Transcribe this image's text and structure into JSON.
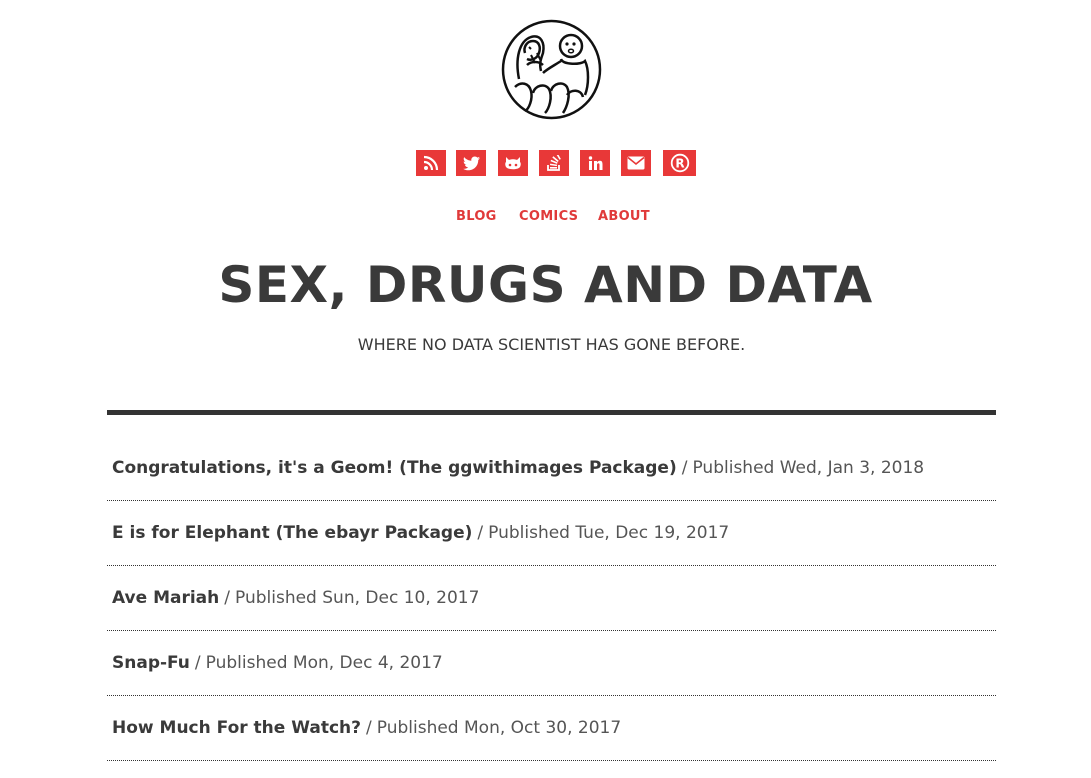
{
  "header": {
    "logo_name": "site-logo",
    "social": [
      {
        "icon": "rss-icon"
      },
      {
        "icon": "twitter-icon"
      },
      {
        "icon": "github-icon"
      },
      {
        "icon": "stackoverflow-icon"
      },
      {
        "icon": "linkedin-icon"
      },
      {
        "icon": "email-icon"
      },
      {
        "icon": "registered-icon",
        "glyph": "®"
      }
    ],
    "nav": [
      {
        "label": "BLOG"
      },
      {
        "label": "COMICS"
      },
      {
        "label": "ABOUT"
      }
    ],
    "title": "SEX, DRUGS AND DATA",
    "tagline": "WHERE NO DATA SCIENTIST HAS GONE BEFORE."
  },
  "colors": {
    "accent": "#e83838",
    "text": "#3a3a3a",
    "rule": "#333333"
  },
  "posts": [
    {
      "title": "Congratulations, it's a Geom! (The ggwithimages Package)",
      "separator": "/",
      "published": "Published Wed, Jan 3, 2018"
    },
    {
      "title": "E is for Elephant (The ebayr Package)",
      "separator": "/",
      "published": "Published Tue, Dec 19, 2017"
    },
    {
      "title": "Ave Mariah",
      "separator": "/",
      "published": "Published Sun, Dec 10, 2017"
    },
    {
      "title": "Snap-Fu",
      "separator": "/",
      "published": "Published Mon, Dec 4, 2017"
    },
    {
      "title": "How Much For the Watch?",
      "separator": "/",
      "published": "Published Mon, Oct 30, 2017"
    }
  ]
}
